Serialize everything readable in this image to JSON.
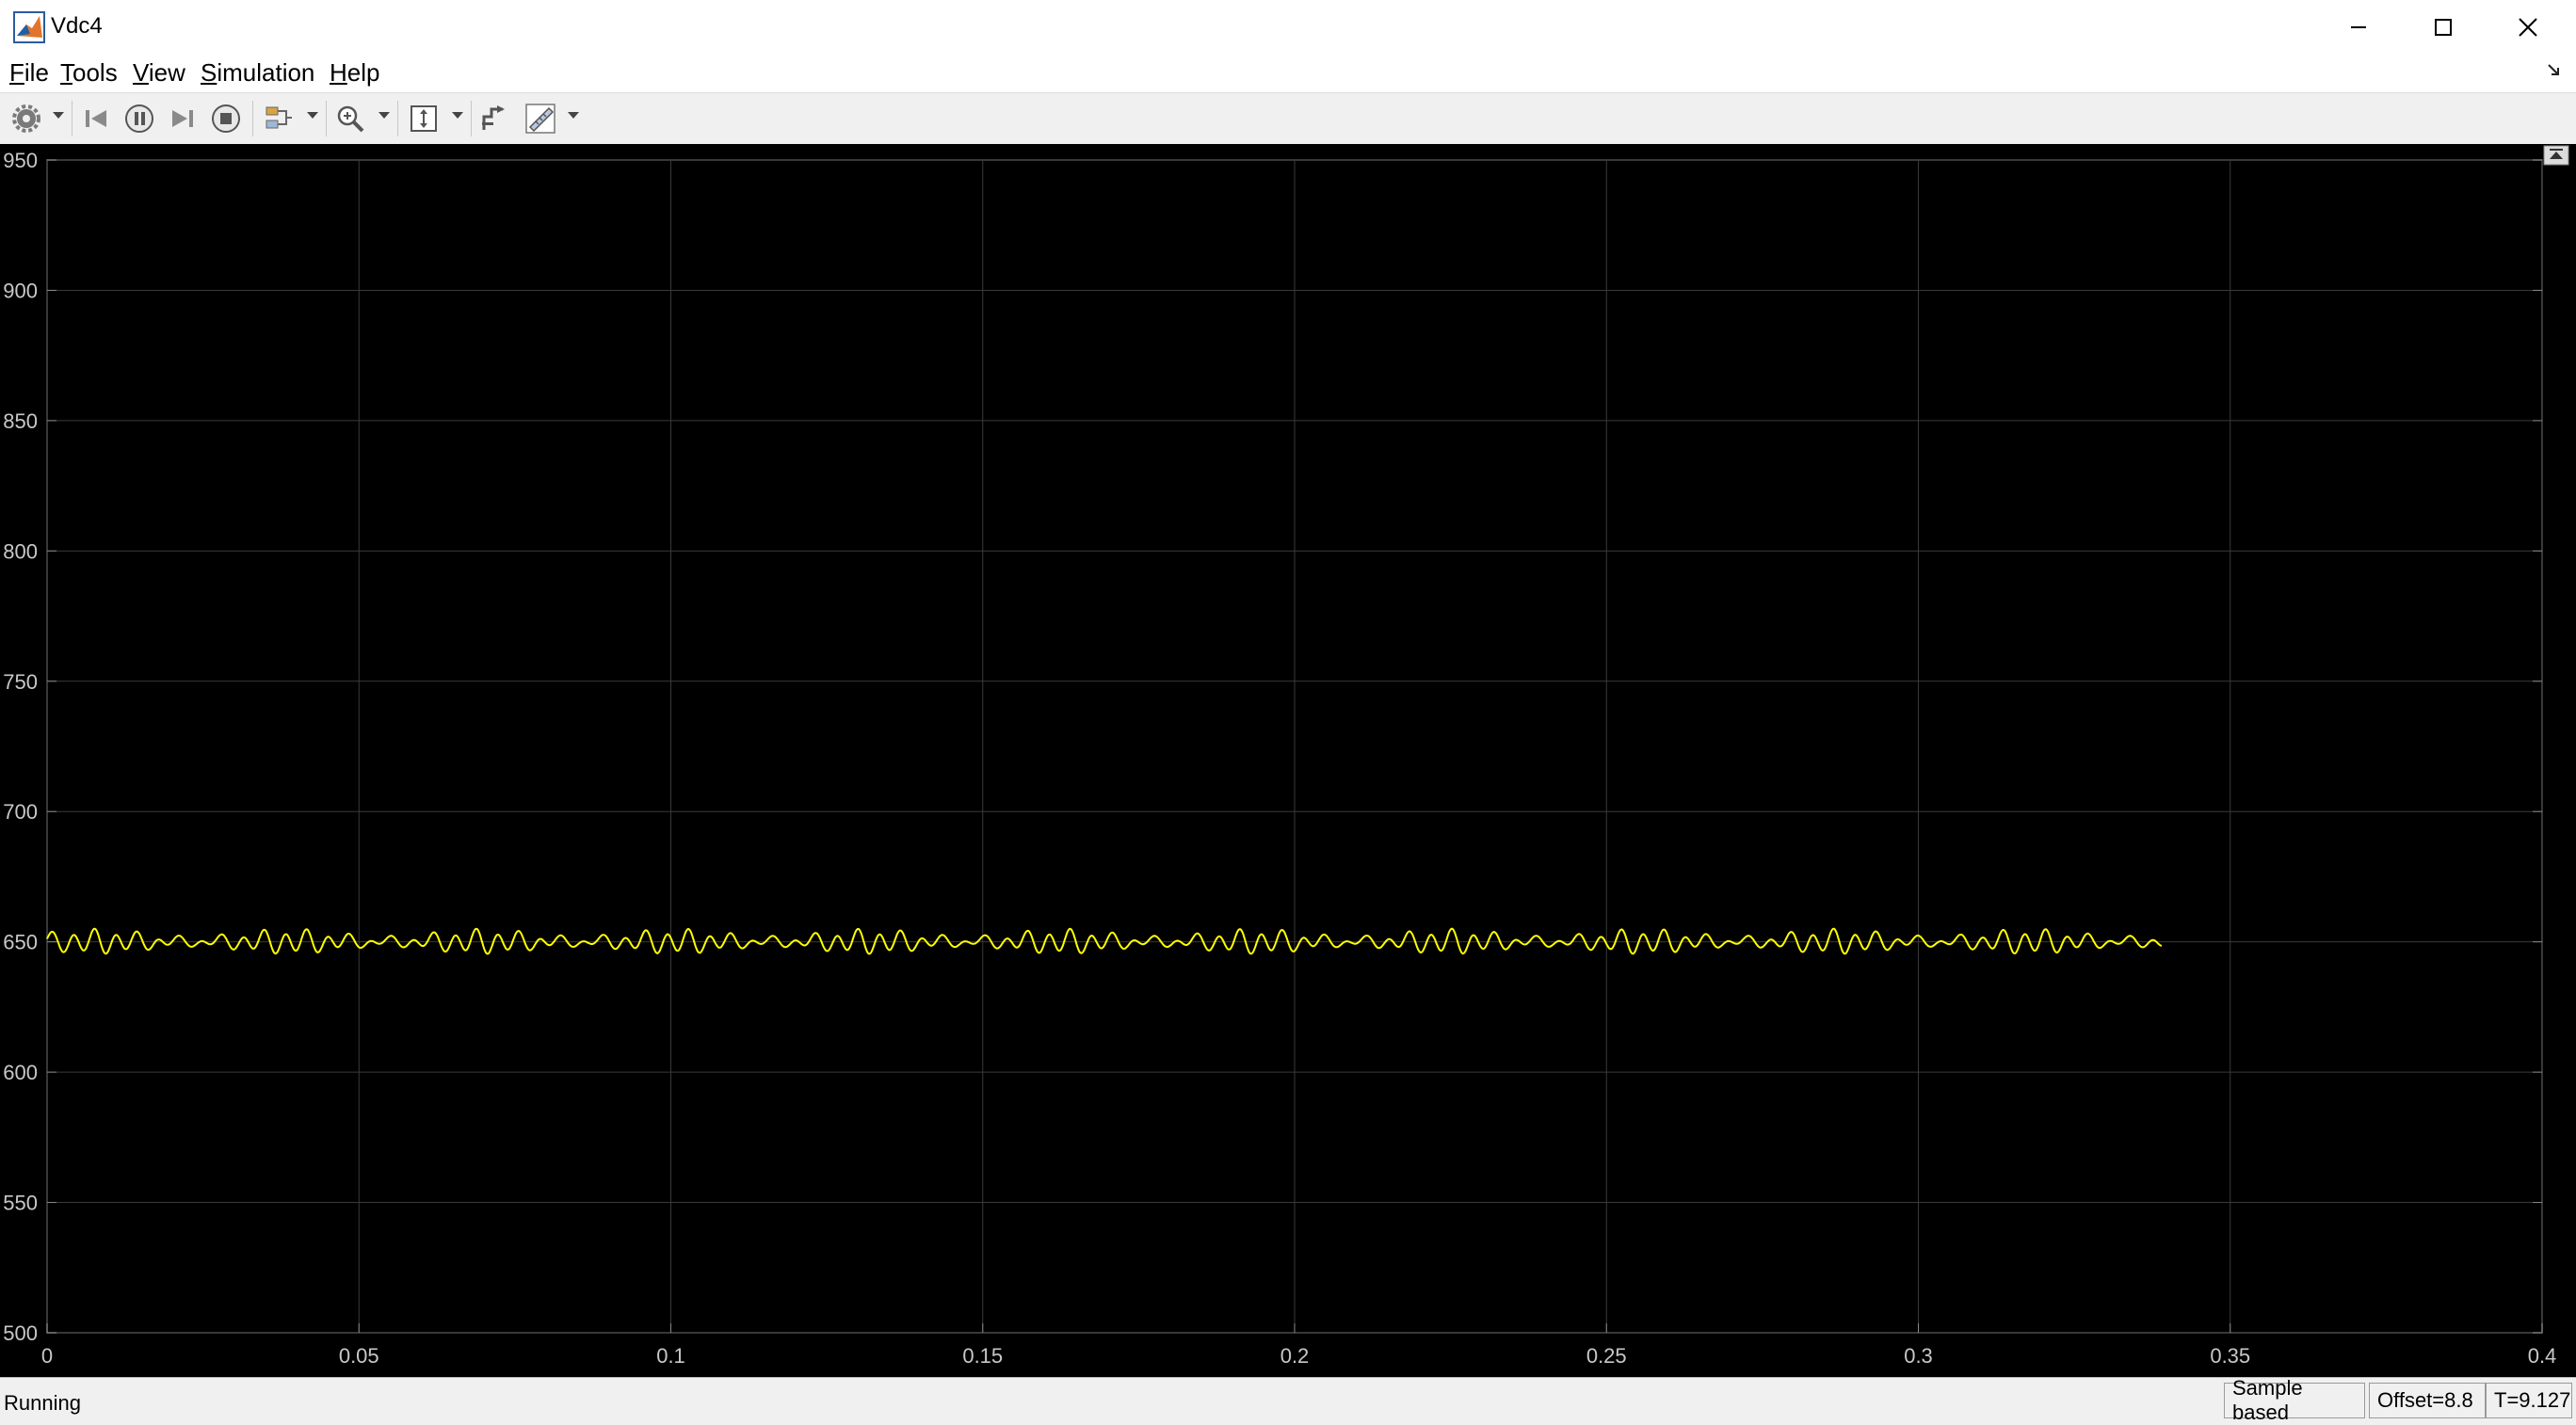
{
  "window": {
    "title": "Vdc4",
    "controls": {
      "minimize": "minimize-icon",
      "maximize": "maximize-icon",
      "close": "close-icon"
    }
  },
  "menu": {
    "items": [
      "File",
      "Tools",
      "View",
      "Simulation",
      "Help"
    ]
  },
  "toolbar": {
    "icons": [
      "settings-gear-icon",
      "step-back-icon",
      "pause-icon",
      "step-forward-icon",
      "stop-icon",
      "highlight-block-icon",
      "zoom-icon",
      "scale-axes-icon",
      "signal-restore-icon",
      "measurements-icon"
    ]
  },
  "status": {
    "state": "Running",
    "sample_mode": "Sample based",
    "offset": "Offset=8.8",
    "time": "T=9.127"
  },
  "colors": {
    "plot_background": "#000000",
    "grid": "#3a3a3a",
    "axis_text": "#c8c8c8",
    "signal": "#ffff00"
  },
  "chart_data": {
    "type": "line",
    "xlim": [
      0,
      0.4
    ],
    "ylim": [
      500,
      950
    ],
    "xticks": [
      "0",
      "0.05",
      "0.1",
      "0.15",
      "0.2",
      "0.25",
      "0.3",
      "0.35",
      "0.4"
    ],
    "yticks": [
      "500",
      "550",
      "600",
      "650",
      "700",
      "750",
      "800",
      "850",
      "900",
      "950"
    ],
    "grid": true,
    "series": [
      {
        "color": "#ffff00",
        "x_start": 0,
        "x_end": 0.339,
        "mean": 650,
        "ripple_amplitude": 4,
        "ripple_period": 0.0034
      }
    ]
  }
}
